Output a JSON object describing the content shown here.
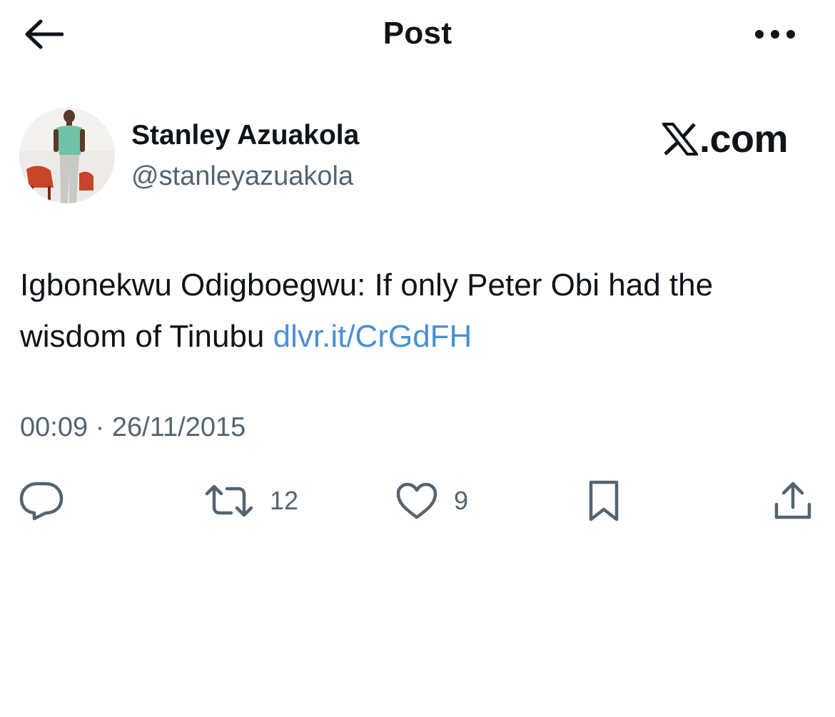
{
  "header": {
    "title": "Post"
  },
  "author": {
    "name": "Stanley Azuakola",
    "handle": "@stanleyazuakola"
  },
  "watermark": {
    "text": ".com"
  },
  "tweet": {
    "text": "Igbonekwu Odigboegwu: If only Peter Obi had the wisdom of Tinubu ",
    "link": "dlvr.it/CrGdFH",
    "timestamp": "00:09 · 26/11/2015"
  },
  "actions": {
    "retweets": "12",
    "likes": "9"
  },
  "colors": {
    "link": "#4a8fd4",
    "secondary_text": "#536471",
    "primary_text": "#0f1419"
  },
  "icons": [
    "back-arrow-icon",
    "more-icon",
    "x-logo-icon",
    "reply-icon",
    "retweet-icon",
    "like-icon",
    "bookmark-icon",
    "share-icon"
  ]
}
